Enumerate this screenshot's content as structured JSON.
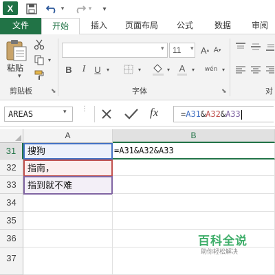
{
  "qat": {
    "app_logo": "X",
    "icons": [
      "save-icon",
      "undo-icon",
      "redo-icon",
      "customize-icon"
    ]
  },
  "tabs": [
    "文件",
    "开始",
    "插入",
    "页面布局",
    "公式",
    "数据",
    "审阅"
  ],
  "ribbon": {
    "clipboard": {
      "paste_label": "粘贴",
      "group_label": "剪贴板"
    },
    "font": {
      "font_size": "11",
      "group_label": "字体",
      "bold": "B",
      "italic": "I",
      "underline": "U",
      "phonetic": "wén",
      "font_color_letter": "A",
      "grow": "A",
      "shrink": "A"
    },
    "alignment": {
      "group_label": "对"
    }
  },
  "formula_bar": {
    "name_box": "AREAS",
    "fx": "fx",
    "formula": {
      "prefix": "=",
      "ref1": "A31",
      "amp1": "&",
      "ref2": "A32",
      "amp2": "&",
      "ref3": "A33"
    }
  },
  "grid": {
    "columns": [
      "A",
      "B"
    ],
    "rows": [
      "31",
      "32",
      "33",
      "34",
      "35",
      "36",
      "37"
    ],
    "cells": {
      "A31": "搜狗",
      "A32": "指南，",
      "A33": "指到就不难",
      "B31": "=A31&A32&A33"
    }
  },
  "colors": {
    "accent": "#217346",
    "ref1": "#4472c4",
    "ref2": "#c0504d",
    "ref3": "#8064a2"
  },
  "watermark": {
    "title": "百科全说",
    "subtitle": "助你轻松解决"
  }
}
